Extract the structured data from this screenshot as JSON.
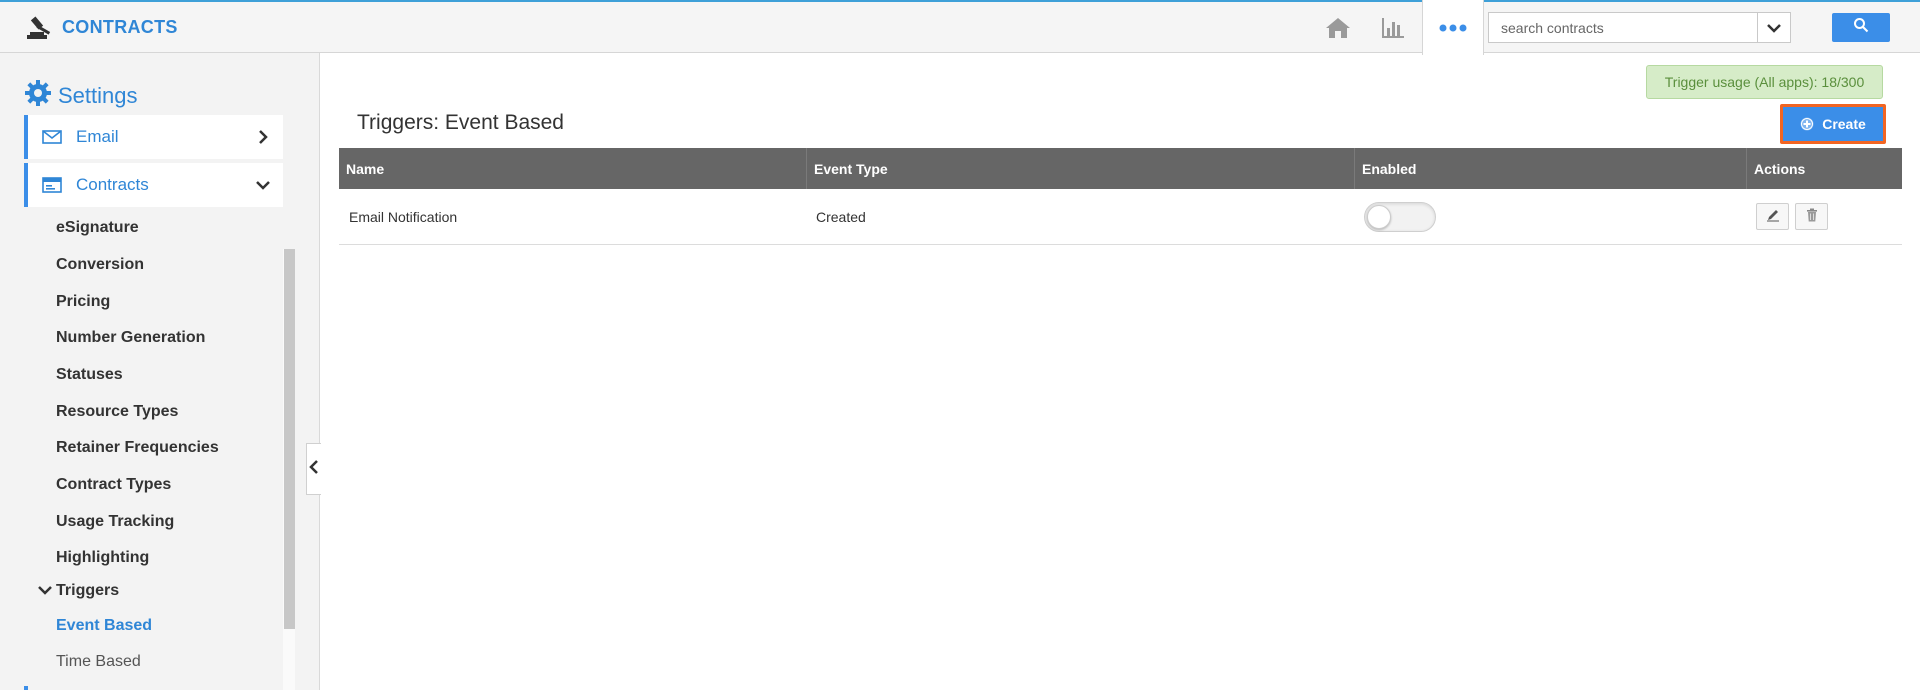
{
  "app": {
    "title": "CONTRACTS",
    "brand_color": "#2f86d6",
    "accent_color": "#3b8ee8"
  },
  "header": {
    "nav_icons": [
      "home-icon",
      "bar-chart-icon",
      "more-dots-icon"
    ],
    "search": {
      "placeholder": "search contracts",
      "value": ""
    }
  },
  "sidebar": {
    "title": "Settings",
    "cards": [
      {
        "label": "Email",
        "icon": "envelope-icon",
        "chevron": "chevron-right-icon"
      },
      {
        "label": "Contracts",
        "icon": "contracts-icon",
        "chevron": "chevron-down-icon"
      }
    ],
    "items": [
      {
        "label": "eSignature"
      },
      {
        "label": "Conversion"
      },
      {
        "label": "Pricing"
      },
      {
        "label": "Number Generation"
      },
      {
        "label": "Statuses"
      },
      {
        "label": "Resource Types"
      },
      {
        "label": "Retainer Frequencies"
      },
      {
        "label": "Contract Types"
      },
      {
        "label": "Usage Tracking"
      },
      {
        "label": "Highlighting"
      }
    ],
    "triggers": {
      "label": "Triggers",
      "children": [
        {
          "label": "Event Based",
          "active": true
        },
        {
          "label": "Time Based",
          "active": false
        }
      ]
    }
  },
  "main": {
    "usage_badge": "Trigger usage (All apps): 18/300",
    "title": "Triggers: Event Based",
    "create_label": "Create",
    "table": {
      "columns": [
        "Name",
        "Event Type",
        "Enabled",
        "Actions"
      ],
      "rows": [
        {
          "name": "Email Notification",
          "event_type": "Created",
          "enabled": false
        }
      ]
    }
  }
}
